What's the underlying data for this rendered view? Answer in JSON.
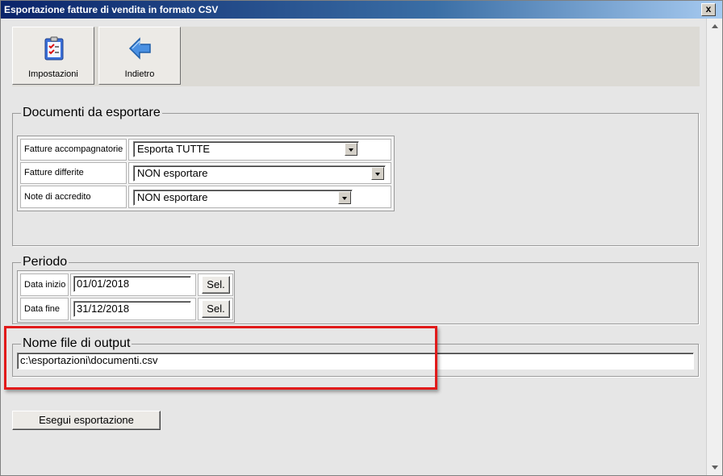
{
  "window": {
    "title": "Esportazione fatture di vendita in formato CSV",
    "close_glyph": "x"
  },
  "toolbar": {
    "settings": {
      "label": "Impostazioni",
      "icon": "checklist-icon"
    },
    "back": {
      "label": "Indietro",
      "icon": "arrow-left-icon"
    }
  },
  "documents": {
    "title": "Documenti da esportare",
    "rows": [
      {
        "label": "Fatture accompagnatorie",
        "value": "Esporta TUTTE"
      },
      {
        "label": "Fatture differite",
        "value": "NON esportare"
      },
      {
        "label": "Note di accredito",
        "value": "NON esportare"
      }
    ]
  },
  "period": {
    "title": "Periodo",
    "start": {
      "label": "Data inizio",
      "value": "01/01/2018",
      "button": "Sel."
    },
    "end": {
      "label": "Data fine",
      "value": "31/12/2018",
      "button": "Sel."
    }
  },
  "output": {
    "title": "Nome file di output",
    "value": "c:\\esportazioni\\documenti.csv"
  },
  "actions": {
    "export_label": "Esegui esportazione"
  },
  "colors": {
    "highlight": "#e11a1a",
    "titlebar": "#0a246a"
  }
}
